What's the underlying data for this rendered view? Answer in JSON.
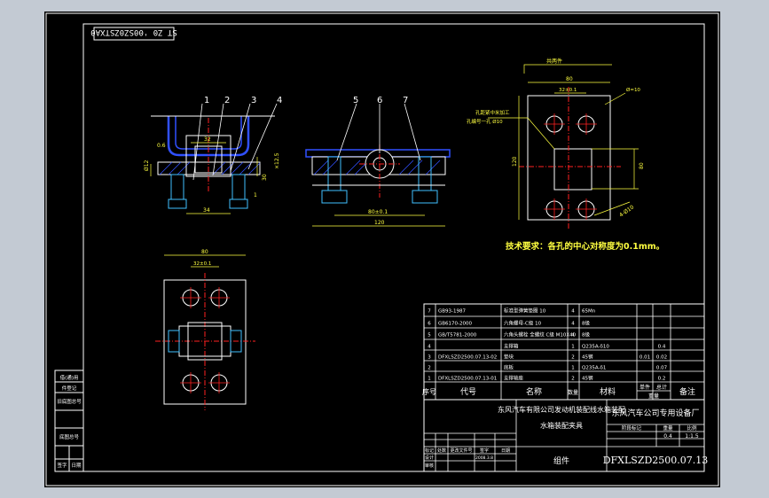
{
  "drawing": {
    "code_box": "ST Z0 '00SZ0ZSTXA0",
    "views": {
      "front_labels": [
        "1",
        "2",
        "3",
        "4"
      ],
      "side_labels": [
        "5",
        "6",
        "7"
      ],
      "front_dims": [
        "32",
        "0.6",
        "Ø12",
        "30",
        "×12.5",
        "34",
        "1"
      ],
      "side_dims": [
        "80±0.1",
        "120"
      ],
      "right_dims": [
        "共两件",
        "80",
        "32±0.1",
        "Ø=10",
        "孔距紧中米加工",
        "孔编号一孔 Ø10",
        "120",
        "80",
        "4-Ø10"
      ],
      "bottom_dims": [
        "80",
        "32±0.1"
      ],
      "tech_note": "技术要求：各孔的中心对称度为0.1mm。"
    },
    "bom": {
      "rows": [
        {
          "no": "7",
          "code": "GB93-1987",
          "name": "标准型弹簧垫圈 10",
          "qty": "4",
          "material": "65Mn",
          "unit": "",
          "total": "",
          "remark": ""
        },
        {
          "no": "6",
          "code": "GB6170-2000",
          "name": "六角螺母-C级 10",
          "qty": "4",
          "material": "8级",
          "unit": "",
          "total": "",
          "remark": ""
        },
        {
          "no": "5",
          "code": "GB/T5781-2000",
          "name": "六角头螺栓 全螺纹 C级 M10X40",
          "qty": "4",
          "material": "8级",
          "unit": "",
          "total": "",
          "remark": ""
        },
        {
          "no": "4",
          "code": "",
          "name": "支撑箱",
          "qty": "1",
          "material": "Q235A-δ10",
          "unit": "",
          "total": "0.4",
          "remark": ""
        },
        {
          "no": "3",
          "code": "DFXLSZD2500.07.13-02",
          "name": "垫块",
          "qty": "2",
          "material": "45钢",
          "unit": "0.01",
          "total": "0.02",
          "remark": ""
        },
        {
          "no": "2",
          "code": "",
          "name": "底板",
          "qty": "1",
          "material": "Q235A-δ1",
          "unit": "",
          "total": "0.07",
          "remark": ""
        },
        {
          "no": "1",
          "code": "DFXLSZD2500.07.13-01",
          "name": "支撑轴座",
          "qty": "2",
          "material": "45钢",
          "unit": "",
          "total": "0.2",
          "remark": ""
        }
      ],
      "header": {
        "no": "序号",
        "code": "代号",
        "name": "名称",
        "qty": "数量",
        "material": "材料",
        "unit": "单件",
        "total": "总计",
        "weight": "重量",
        "remark": "备注"
      }
    },
    "title_block": {
      "project": "东风汽车有限公司发动机装配线水箱装配",
      "project_sub": "水箱装配夹具",
      "company": "东风汽车公司专用设备厂",
      "part_name": "组件",
      "drawing_no": "DFXLSZD2500.07.13",
      "stage_label": "阶段标记",
      "weight_label": "重量",
      "scale_label": "比例",
      "weight": "0.4",
      "scale": "1:1.5",
      "rev_headers": [
        "标记",
        "处数",
        "更改文件号",
        "签字",
        "日期"
      ],
      "design": "设计",
      "design_date": "2008.3.8",
      "check": "审核"
    },
    "left_margin": [
      "借(通)用",
      "件登记",
      "旧底图总号",
      "底图总号",
      "签字",
      "日期"
    ],
    "colors": {
      "paper": "#000000",
      "frame": "#ffffff",
      "part": "#ffffff",
      "center_line": "#ff2020",
      "dimension": "#ffff40",
      "hatch": "#3050ff",
      "bolt": "#40c0ff",
      "background": "#c3cad3"
    }
  }
}
